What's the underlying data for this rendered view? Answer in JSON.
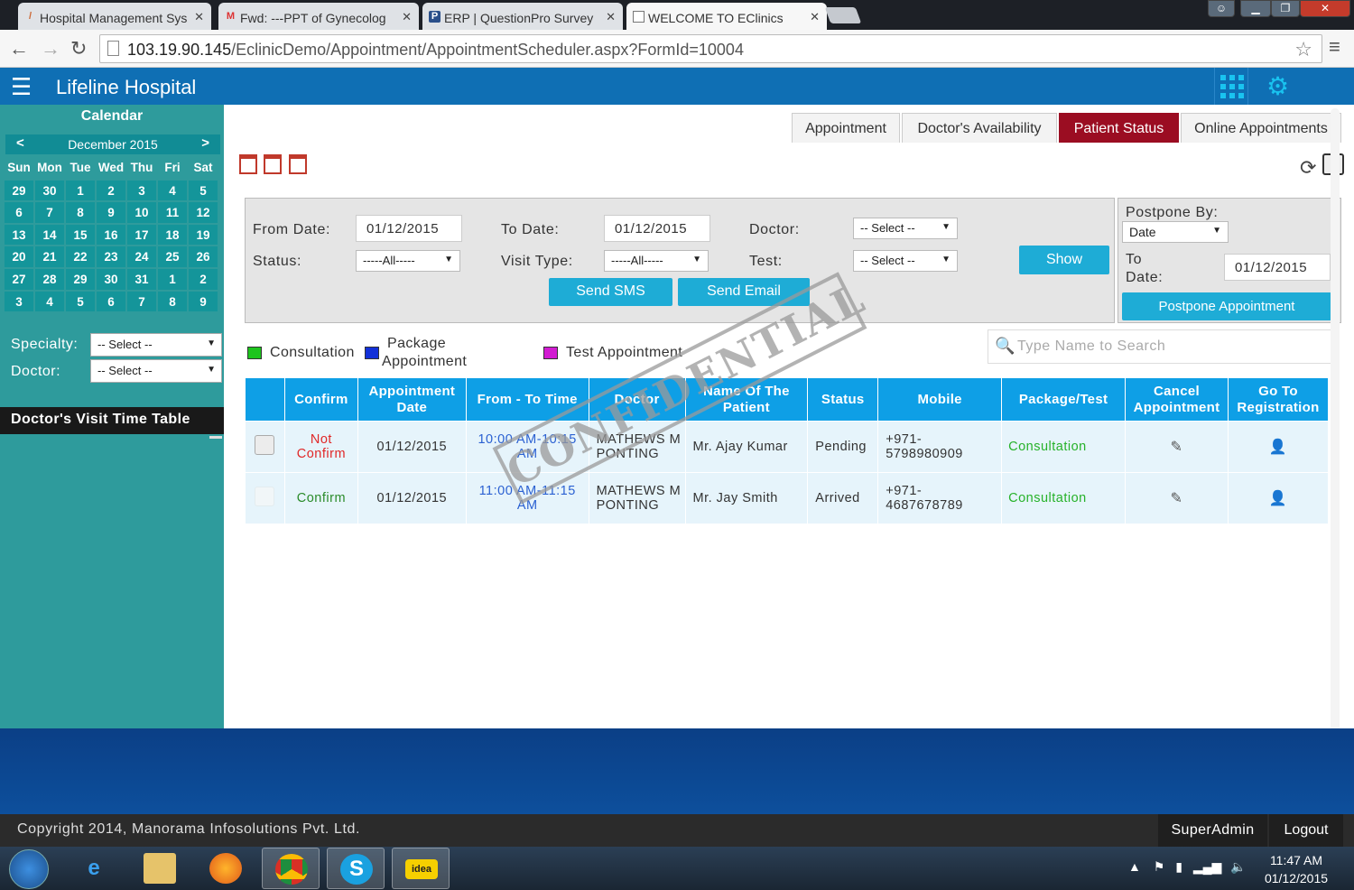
{
  "browser": {
    "tabs": [
      {
        "label": "Hospital Management Sys",
        "icon": "M"
      },
      {
        "label": "Fwd: ---PPT of Gynecolog",
        "icon": "M"
      },
      {
        "label": "ERP | QuestionPro Survey",
        "icon": "P"
      },
      {
        "label": "WELCOME TO EClinics",
        "icon": ""
      }
    ],
    "url_host": "103.19.90.145",
    "url_path": "/EclinicDemo/Appointment/AppointmentScheduler.aspx?FormId=10004"
  },
  "app": {
    "title": "Lifeline Hospital"
  },
  "calendar": {
    "title": "Calendar",
    "month": "December 2015",
    "prev": "<",
    "next": ">",
    "weekdays": [
      "Sun",
      "Mon",
      "Tue",
      "Wed",
      "Thu",
      "Fri",
      "Sat"
    ],
    "weeks": [
      [
        "29",
        "30",
        "1",
        "2",
        "3",
        "4",
        "5"
      ],
      [
        "6",
        "7",
        "8",
        "9",
        "10",
        "11",
        "12"
      ],
      [
        "13",
        "14",
        "15",
        "16",
        "17",
        "18",
        "19"
      ],
      [
        "20",
        "21",
        "22",
        "23",
        "24",
        "25",
        "26"
      ],
      [
        "27",
        "28",
        "29",
        "30",
        "31",
        "1",
        "2"
      ],
      [
        "3",
        "4",
        "5",
        "6",
        "7",
        "8",
        "9"
      ]
    ]
  },
  "sidebar": {
    "specialty_label": "Specialty:",
    "specialty_value": "-- Select --",
    "doctor_label": "Doctor:",
    "doctor_value": "-- Select --",
    "visit_timetable": "Doctor's Visit Time Table"
  },
  "tabs": [
    "Appointment",
    "Doctor's Availability",
    "Patient Status",
    "Online Appointments"
  ],
  "filters": {
    "from_date_label": "From Date:",
    "from_date": "01/12/2015",
    "to_date_label": "To Date:",
    "to_date": "01/12/2015",
    "doctor_label": "Doctor:",
    "doctor_value": "-- Select --",
    "status_label": "Status:",
    "status_value": "-----All-----",
    "visit_type_label": "Visit Type:",
    "visit_type_value": "-----All-----",
    "test_label": "Test:",
    "test_value": "-- Select --",
    "show_button": "Show",
    "send_sms": "Send SMS",
    "send_email": "Send Email"
  },
  "postpone": {
    "by_label": "Postpone By:",
    "by_value": "Date",
    "to_label": "To",
    "date_label": "Date:",
    "date_value": "01/12/2015",
    "button": "Postpone Appointment"
  },
  "legend": {
    "consultation": "Consultation",
    "package_line1": "Package",
    "package_line2": "Appointment",
    "test": "Test Appointment",
    "colors": {
      "consultation": "#1dc41d",
      "package": "#1230d8",
      "test": "#d21bd2"
    }
  },
  "search": {
    "placeholder": "Type Name to Search"
  },
  "table": {
    "headers": [
      "",
      "Confirm",
      "Appointment Date",
      "From - To Time",
      "Doctor",
      "Name Of The Patient",
      "Status",
      "Mobile",
      "Package/Test",
      "Cancel Appointment",
      "Go To Registration"
    ],
    "rows": [
      {
        "confirm_l1": "Not",
        "confirm_l2": "Confirm",
        "date": "01/12/2015",
        "time_l1": "10:00 AM-10:15",
        "time_l2": "AM",
        "doctor_l1": "MATHEWS M",
        "doctor_l2": "PONTING",
        "patient": "Mr. Ajay Kumar",
        "status": "Pending",
        "mobile_l1": "+971-",
        "mobile_l2": "5798980909",
        "package": "Consultation"
      },
      {
        "confirm_l1": "Confirm",
        "confirm_l2": "",
        "date": "01/12/2015",
        "time_l1": "11:00 AM-11:15",
        "time_l2": "AM",
        "doctor_l1": "MATHEWS M",
        "doctor_l2": "PONTING",
        "patient": "Mr. Jay Smith",
        "status": "Arrived",
        "mobile_l1": "+971-",
        "mobile_l2": "4687678789",
        "package": "Consultation"
      }
    ]
  },
  "watermark": "CONFIDENTIAL",
  "footer": {
    "copyright": "Copyright 2014, Manorama Infosolutions Pvt. Ltd.",
    "user": "SuperAdmin",
    "logout": "Logout"
  },
  "taskbar": {
    "time": "11:47 AM",
    "date": "01/12/2015"
  }
}
